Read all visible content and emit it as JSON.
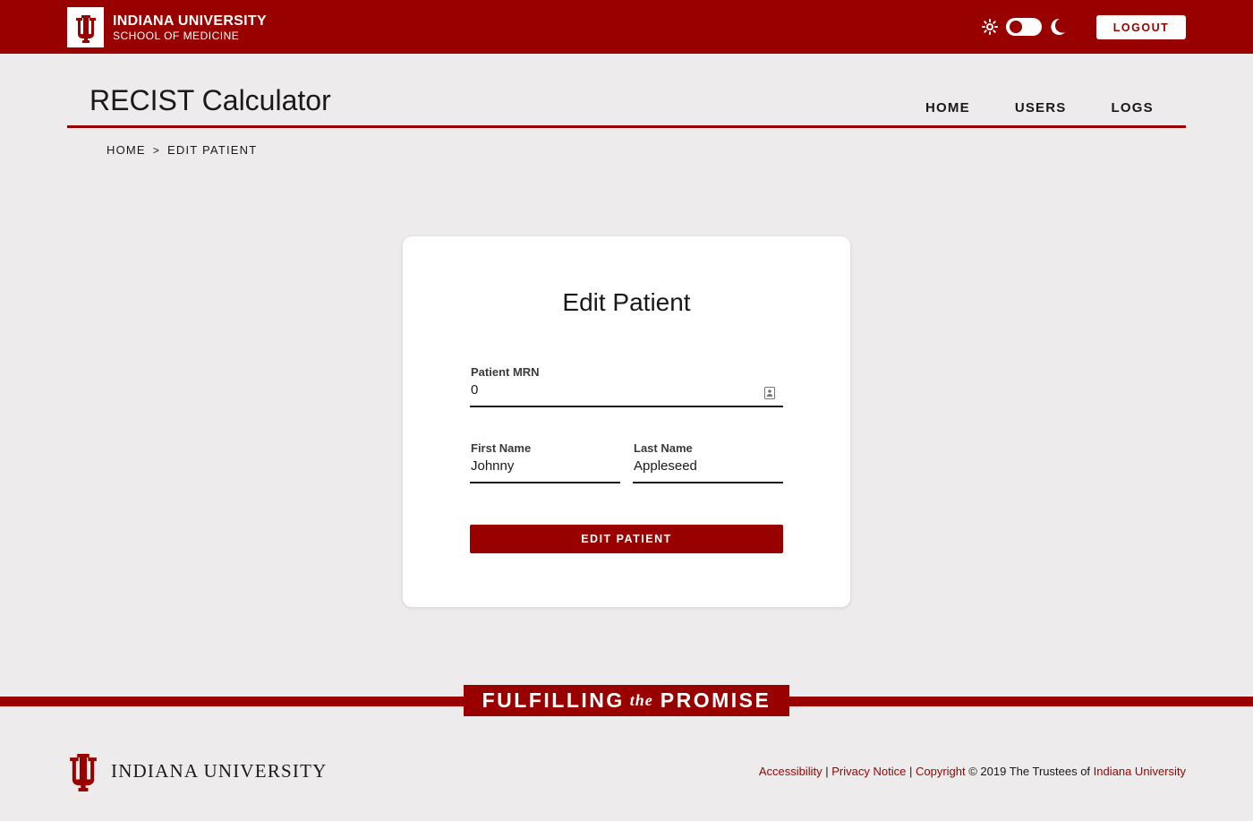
{
  "header": {
    "brand_line1": "INDIANA UNIVERSITY",
    "brand_line2": "SCHOOL OF MEDICINE",
    "logout_label": "LOGOUT"
  },
  "app": {
    "title": "RECIST Calculator",
    "nav": [
      "HOME",
      "USERS",
      "LOGS"
    ]
  },
  "breadcrumb": {
    "home": "HOME",
    "separator": ">",
    "current": "EDIT PATIENT"
  },
  "form": {
    "title": "Edit Patient",
    "mrn_label": "Patient MRN",
    "mrn_value": "0",
    "first_name_label": "First Name",
    "first_name_value": "Johnny",
    "last_name_label": "Last Name",
    "last_name_value": "Appleseed",
    "submit_label": "EDIT PATIENT"
  },
  "footer": {
    "tagline_part1": "FULFILLING",
    "tagline_the": "the",
    "tagline_part2": "PROMISE",
    "logo_name": "INDIANA UNIVERSITY",
    "link_accessibility": "Accessibility",
    "divider": "|",
    "link_privacy": "Privacy Notice",
    "link_copyright": "Copyright",
    "copyright_text": "© 2019 The Trustees of",
    "link_iu": "Indiana University"
  },
  "colors": {
    "brand": "#990000",
    "background": "#edebeb",
    "text": "#191919"
  },
  "icons": {
    "brand_logo": "iu-trident-icon",
    "light_mode": "sun-icon",
    "dark_mode": "moon-icon",
    "mrn_field": "contact-card-icon"
  }
}
